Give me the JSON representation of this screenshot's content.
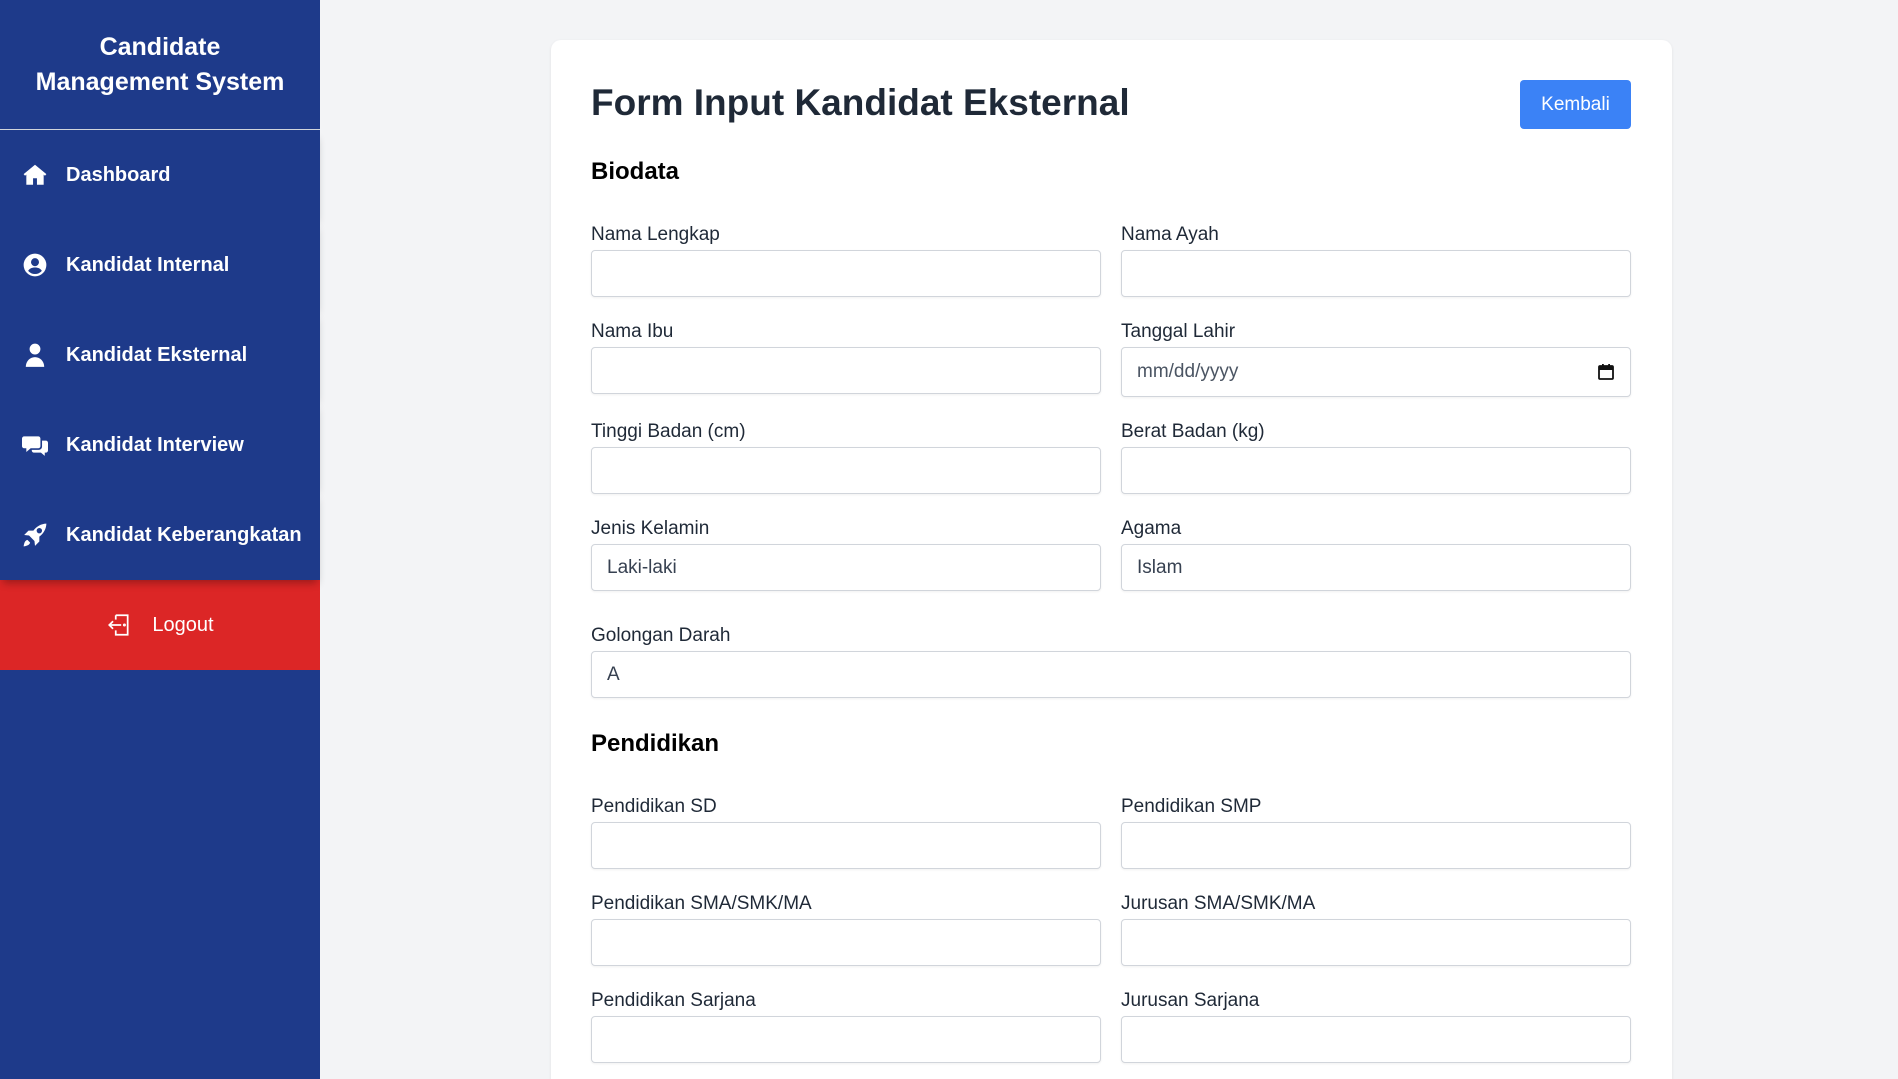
{
  "sidebar": {
    "brand_line1": "Candidate",
    "brand_line2": "Management System",
    "items": [
      {
        "label": "Dashboard",
        "icon": "home-icon"
      },
      {
        "label": "Kandidat Internal",
        "icon": "user-circle-icon"
      },
      {
        "label": "Kandidat Eksternal",
        "icon": "user-icon"
      },
      {
        "label": "Kandidat Interview",
        "icon": "chat-icon"
      },
      {
        "label": "Kandidat Keberangkatan",
        "icon": "rocket-icon"
      }
    ],
    "logout_label": "Logout",
    "logout_icon": "logout-icon",
    "colors": {
      "sidebar": "#1e3a8a",
      "logout": "#dc2626"
    }
  },
  "form": {
    "title": "Form Input Kandidat Eksternal",
    "back_label": "Kembali",
    "accent": "#3b82f6",
    "biodata": {
      "heading": "Biodata",
      "nama_lengkap": {
        "label": "Nama Lengkap",
        "value": ""
      },
      "nama_ayah": {
        "label": "Nama Ayah",
        "value": ""
      },
      "nama_ibu": {
        "label": "Nama Ibu",
        "value": ""
      },
      "tanggal_lahir": {
        "label": "Tanggal Lahir",
        "placeholder": "mm/dd/yyyy"
      },
      "tinggi_badan": {
        "label": "Tinggi Badan (cm)",
        "value": ""
      },
      "berat_badan": {
        "label": "Berat Badan (kg)",
        "value": ""
      },
      "jenis_kelamin": {
        "label": "Jenis Kelamin",
        "value": "Laki-laki"
      },
      "agama": {
        "label": "Agama",
        "value": "Islam"
      },
      "golongan_darah": {
        "label": "Golongan Darah",
        "value": "A"
      }
    },
    "pendidikan": {
      "heading": "Pendidikan",
      "sd": {
        "label": "Pendidikan SD",
        "value": ""
      },
      "smp": {
        "label": "Pendidikan SMP",
        "value": ""
      },
      "sma": {
        "label": "Pendidikan SMA/SMK/MA",
        "value": ""
      },
      "jurusan_sma": {
        "label": "Jurusan SMA/SMK/MA",
        "value": ""
      },
      "sarjana": {
        "label": "Pendidikan Sarjana",
        "value": ""
      },
      "jurusan_sarjana": {
        "label": "Jurusan Sarjana",
        "value": ""
      }
    }
  }
}
